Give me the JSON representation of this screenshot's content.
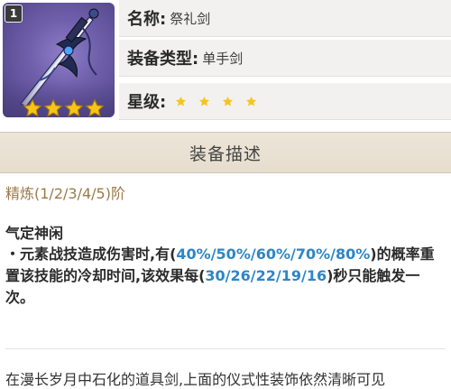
{
  "weapon": {
    "refinement_badge": "1",
    "portrait_rarity_stars": 4,
    "name_label": "名称:",
    "name_value": "祭礼剑",
    "type_label": "装备类型:",
    "type_value": "单手剑",
    "rarity_label": "星级:",
    "rarity": 4
  },
  "section": {
    "title": "装备描述"
  },
  "description": {
    "refine_line": "精炼(1/2/3/4/5)阶",
    "passive_name": "气定神闲",
    "passive_prefix": "・元素战技造成伤害时,有(",
    "passive_values_1": "40%/50%/60%/70%/80%",
    "passive_mid": ")的概率重置该技能的冷却时间,该效果每(",
    "passive_values_2": "30/26/22/19/16",
    "passive_suffix": ")秒只能触发一次。",
    "lore_partial": "在漫长岁月中石化的道具剑,上面的仪式性装饰依然清晰可见"
  },
  "colors": {
    "portrait_bg": "#6f5fab",
    "star_gold": "#f5c518",
    "highlight_blue": "#2d86c7",
    "refine_text": "#9a7a4a",
    "header_bg": "#ece5d8"
  },
  "icons": {
    "star": "star-icon",
    "sword": "sword-icon"
  }
}
